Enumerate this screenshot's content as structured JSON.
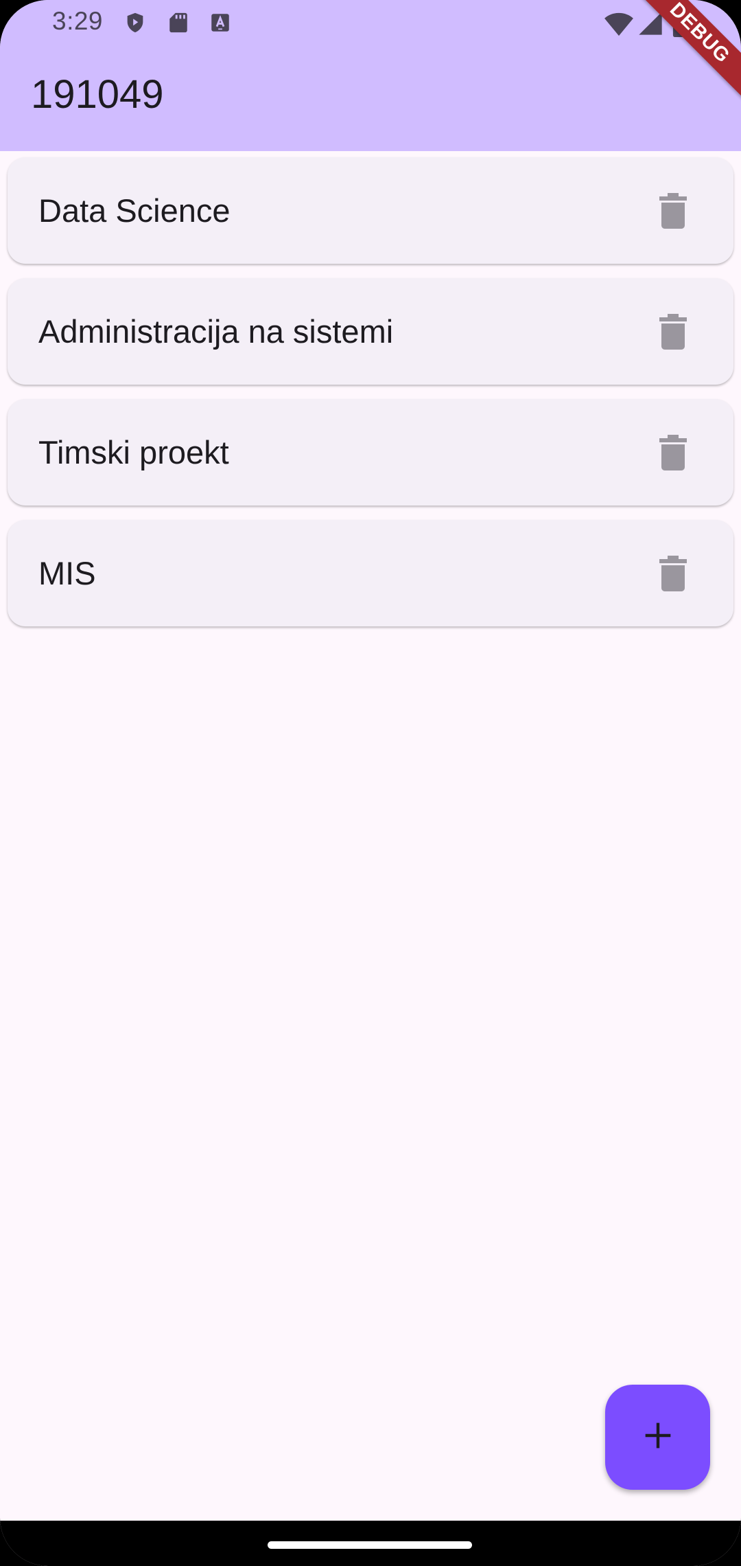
{
  "status_bar": {
    "time": "3:29",
    "left_icons": [
      "shield-icon",
      "sd-card-icon",
      "keyboard-a-icon"
    ],
    "right_icons": [
      "wifi-icon",
      "cell-signal-icon",
      "battery-icon"
    ]
  },
  "debug_banner": {
    "label": "DEBUG",
    "color": "#a8282e"
  },
  "app_bar": {
    "title": "191049",
    "background": "#d0bcff"
  },
  "list": {
    "items": [
      {
        "label": "Data Science",
        "action_icon": "delete-icon"
      },
      {
        "label": "Administracija na sistemi",
        "action_icon": "delete-icon"
      },
      {
        "label": "Timski proekt",
        "action_icon": "delete-icon"
      },
      {
        "label": "MIS",
        "action_icon": "delete-icon"
      }
    ]
  },
  "fab": {
    "icon": "add-icon",
    "color": "#7c4dff"
  },
  "colors": {
    "page_background": "#fef7fd",
    "card_background": "#f4eff7",
    "icon_gray": "#9a969e"
  }
}
